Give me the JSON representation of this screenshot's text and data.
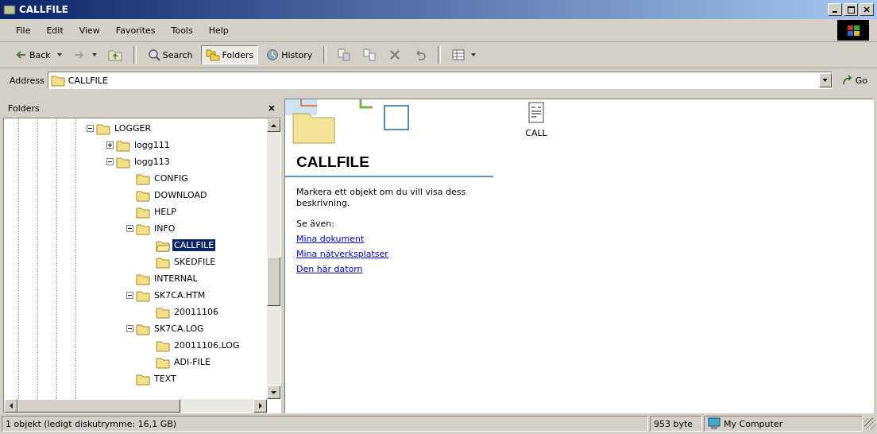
{
  "window": {
    "title": "CALLFILE"
  },
  "menu": [
    "File",
    "Edit",
    "View",
    "Favorites",
    "Tools",
    "Help"
  ],
  "toolbar": [
    {
      "kind": "back",
      "label": "Back",
      "selected": false
    },
    {
      "kind": "forward",
      "selected": false
    },
    {
      "kind": "up",
      "selected": false
    },
    {
      "kind": "search",
      "label": "Search",
      "selected": false
    },
    {
      "kind": "folders",
      "label": "Folders",
      "selected": true
    },
    {
      "kind": "history",
      "label": "History",
      "selected": false
    },
    {
      "kind": "move",
      "selected": false
    },
    {
      "kind": "copy",
      "selected": false
    },
    {
      "kind": "delete",
      "selected": false
    },
    {
      "kind": "undo",
      "selected": false
    },
    {
      "kind": "views",
      "selected": false
    }
  ],
  "address": {
    "label": "Address",
    "value": "CALLFILE",
    "go": "Go"
  },
  "folders_pane": {
    "title": "Folders",
    "tree": [
      {
        "label": "LOGGER",
        "expanded": true,
        "selected": false,
        "children": [
          {
            "label": "logg111",
            "expanded": false,
            "selected": false
          },
          {
            "label": "logg113",
            "expanded": true,
            "selected": false,
            "children": [
              {
                "label": "CONFIG",
                "selected": false
              },
              {
                "label": "DOWNLOAD",
                "selected": false
              },
              {
                "label": "HELP",
                "selected": false
              },
              {
                "label": "INFO",
                "expanded": true,
                "selected": false,
                "children": [
                  {
                    "label": "CALLFILE",
                    "selected": true
                  },
                  {
                    "label": "SKEDFILE",
                    "selected": false
                  }
                ]
              },
              {
                "label": "INTERNAL",
                "selected": false
              },
              {
                "label": "SK7CA.HTM",
                "expanded": true,
                "selected": false,
                "children": [
                  {
                    "label": "20011106",
                    "selected": false
                  }
                ]
              },
              {
                "label": "SK7CA.LOG",
                "expanded": true,
                "selected": false,
                "children": [
                  {
                    "label": "20011106.LOG",
                    "selected": false
                  },
                  {
                    "label": "ADI-FILE",
                    "selected": false
                  }
                ]
              },
              {
                "label": "TEXT",
                "selected": false
              }
            ]
          }
        ]
      }
    ]
  },
  "info_panel": {
    "title": "CALLFILE",
    "description": "Markera ett objekt om du vill visa dess beskrivning.",
    "see_also": "Se även:",
    "links": [
      "Mina dokument",
      "Mina nätverksplatser",
      "Den här datorn"
    ]
  },
  "files": [
    {
      "name": "CALL",
      "selected": false
    }
  ],
  "status_bar": {
    "objects": "1 objekt (ledigt diskutrymme: 16,1 GB)",
    "size": "953 byte",
    "zone": "My Computer"
  }
}
